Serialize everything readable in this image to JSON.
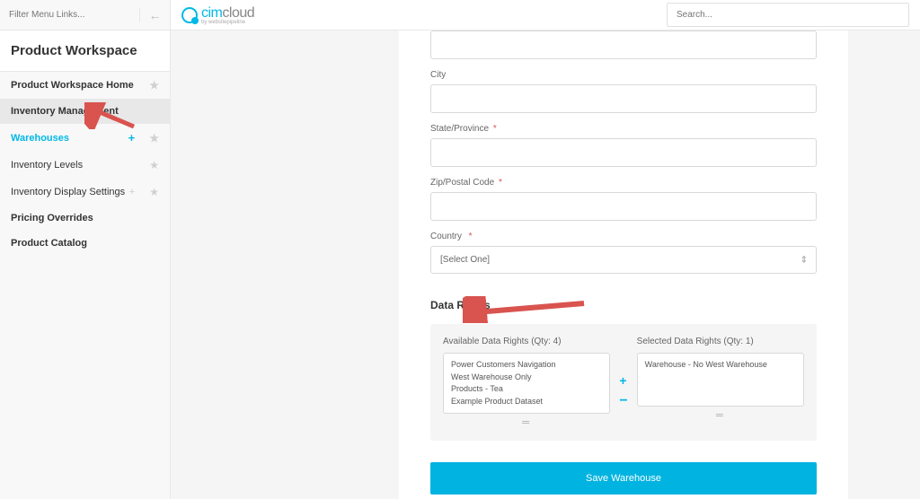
{
  "sidebar": {
    "filter_placeholder": "Filter Menu Links...",
    "workspace_title": "Product Workspace",
    "items": [
      {
        "label": "Product Workspace Home",
        "id": "home",
        "bold": true,
        "has_star": true
      },
      {
        "label": "Inventory Management",
        "id": "inventory-management",
        "selected": true
      },
      {
        "label": "Warehouses",
        "id": "warehouses",
        "active": true,
        "has_star": true,
        "has_plus": true
      },
      {
        "label": "Inventory Levels",
        "id": "inventory-levels",
        "has_star": true
      },
      {
        "label": "Inventory Display Settings",
        "id": "inventory-display-settings",
        "has_star": true,
        "has_plus_gray": true
      },
      {
        "label": "Pricing Overrides",
        "id": "pricing-overrides",
        "bold": true
      },
      {
        "label": "Product Catalog",
        "id": "product-catalog",
        "bold": true
      }
    ]
  },
  "header": {
    "logo_cim": "cim",
    "logo_cloud": "cloud",
    "logo_sub": "by websitepipeline",
    "search_placeholder": "Search..."
  },
  "form": {
    "city_label": "City",
    "state_label": "State/Province",
    "zip_label": "Zip/Postal Code",
    "country_label": "Country",
    "country_value": "[Select One]",
    "data_rights_heading": "Data Rights",
    "available_label": "Available Data Rights (Qty: 4)",
    "available_items": [
      "Power Customers Navigation",
      "West Warehouse Only",
      "Products - Tea",
      "Example Product Dataset"
    ],
    "selected_label": "Selected Data Rights (Qty: 1)",
    "selected_items": [
      "Warehouse - No West Warehouse"
    ],
    "save_button": "Save Warehouse"
  }
}
